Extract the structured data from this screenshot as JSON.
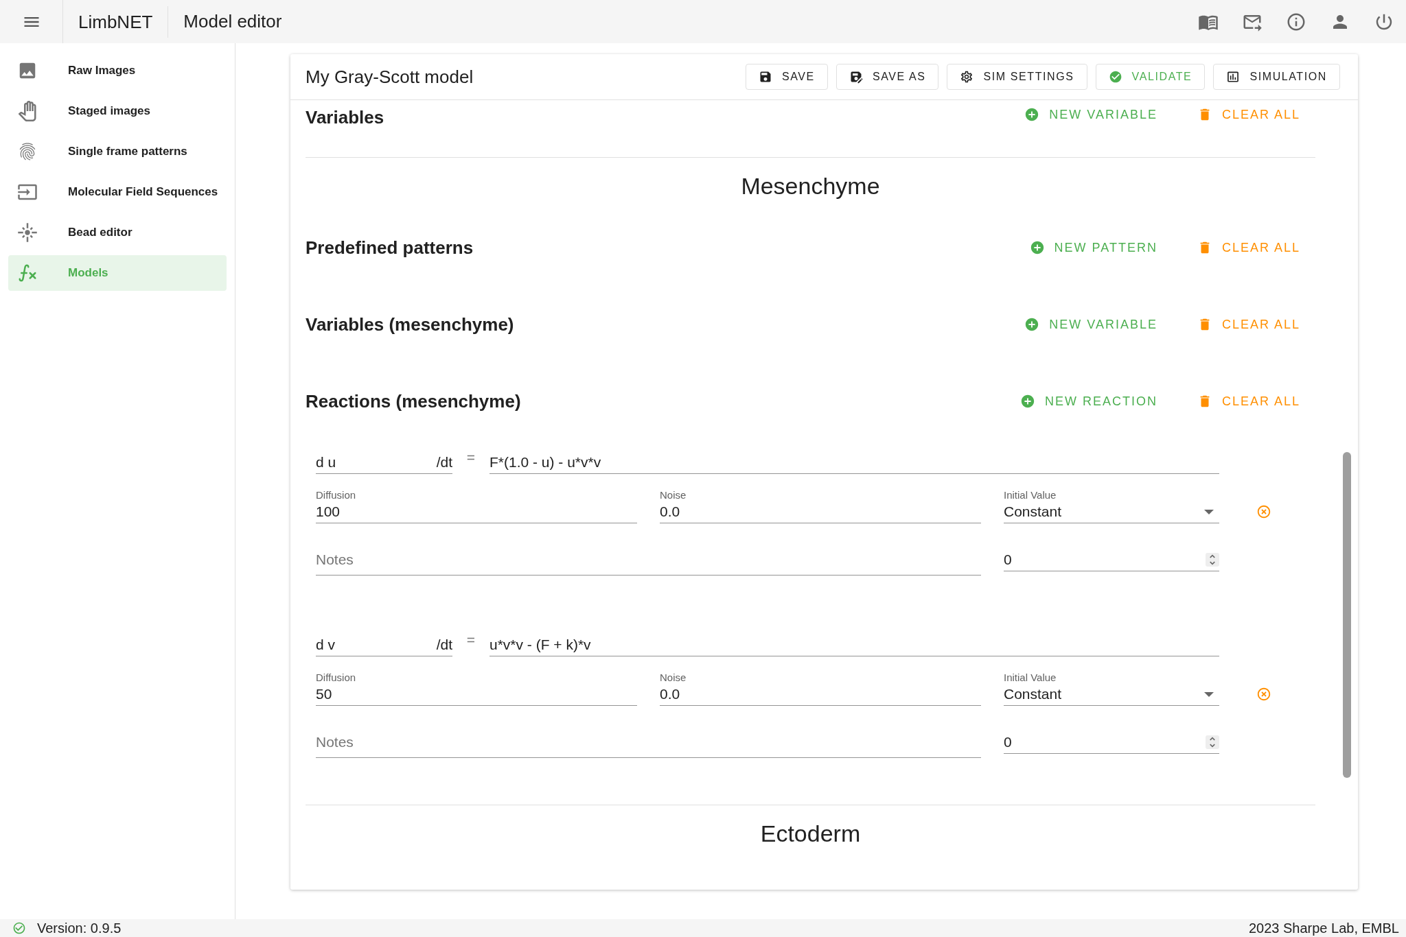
{
  "app": {
    "title": "LimbNET",
    "page": "Model editor"
  },
  "top_icons": [
    {
      "kind": "book"
    },
    {
      "kind": "mail"
    },
    {
      "kind": "info"
    },
    {
      "kind": "account"
    },
    {
      "kind": "power"
    }
  ],
  "sidebar": {
    "items": [
      {
        "label": "Raw Images",
        "kind": "image",
        "selected": false
      },
      {
        "label": "Staged images",
        "kind": "hand",
        "selected": false
      },
      {
        "label": "Single frame patterns",
        "kind": "fingerprint",
        "selected": false
      },
      {
        "label": "Molecular Field Sequences",
        "kind": "sequence",
        "selected": false
      },
      {
        "label": "Bead editor",
        "kind": "bead",
        "selected": false
      },
      {
        "label": "Models",
        "kind": "function",
        "selected": true
      }
    ]
  },
  "editor": {
    "title": "My Gray-Scott model",
    "toolbar": [
      {
        "label": "SAVE",
        "kind": "save"
      },
      {
        "label": "SAVE AS",
        "kind": "save_as"
      },
      {
        "label": "SIM SETTINGS",
        "kind": "settings"
      },
      {
        "label": "VALIDATE",
        "kind": "validate"
      },
      {
        "label": "SIMULATION",
        "kind": "simulation"
      }
    ],
    "variables": {
      "title": "Variables",
      "actions": [
        {
          "label": "NEW VARIABLE",
          "kind": "add"
        },
        {
          "label": "CLEAR ALL",
          "kind": "clear"
        }
      ]
    },
    "compartments": [
      {
        "name": "Mesenchyme",
        "sections": [
          {
            "title": "Predefined patterns",
            "actions": [
              {
                "label": "NEW PATTERN",
                "kind": "add"
              },
              {
                "label": "CLEAR ALL",
                "kind": "clear"
              }
            ]
          },
          {
            "title": "Variables (mesenchyme)",
            "actions": [
              {
                "label": "NEW VARIABLE",
                "kind": "add"
              },
              {
                "label": "CLEAR ALL",
                "kind": "clear"
              }
            ]
          },
          {
            "title": "Reactions (mesenchyme)",
            "actions": [
              {
                "label": "NEW REACTION",
                "kind": "add"
              },
              {
                "label": "CLEAR ALL",
                "kind": "clear"
              }
            ],
            "reactions": [
              {
                "variable": "d u",
                "suffix": "/dt",
                "equals": "=",
                "expression": "F*(1.0 - u) - u*v*v",
                "diffusion": {
                  "label": "Diffusion",
                  "value": "100"
                },
                "noise": {
                  "label": "Noise",
                  "value": "0.0"
                },
                "initial_value": {
                  "label": "Initial Value",
                  "value": "Constant"
                },
                "notes": {
                  "placeholder": "Notes"
                },
                "constant": "0"
              },
              {
                "variable": "d v",
                "suffix": "/dt",
                "equals": "=",
                "expression": "u*v*v - (F + k)*v",
                "diffusion": {
                  "label": "Diffusion",
                  "value": "50"
                },
                "noise": {
                  "label": "Noise",
                  "value": "0.0"
                },
                "initial_value": {
                  "label": "Initial Value",
                  "value": "Constant"
                },
                "notes": {
                  "placeholder": "Notes"
                },
                "constant": "0"
              }
            ]
          }
        ]
      },
      {
        "name": "Ectoderm"
      }
    ]
  },
  "status_bar": {
    "version": "Version: 0.9.5",
    "credit": "2023 Sharpe Lab, EMBL"
  }
}
